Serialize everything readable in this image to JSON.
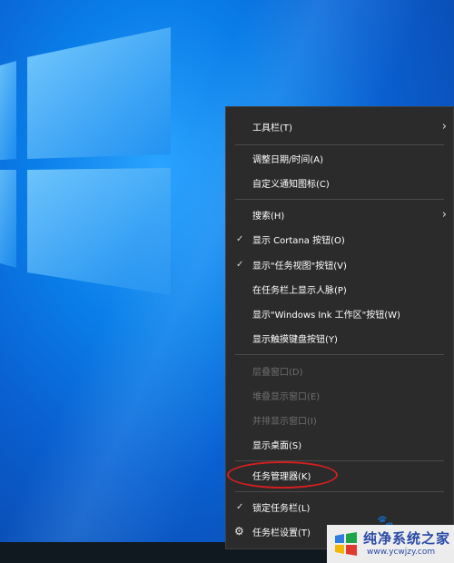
{
  "menu": {
    "items": [
      {
        "label": "工具栏(T)",
        "submenu": true
      },
      {
        "label": "调整日期/时间(A)"
      },
      {
        "label": "自定义通知图标(C)"
      },
      {
        "label": "搜索(H)",
        "submenu": true
      },
      {
        "label": "显示 Cortana 按钮(O)",
        "checked": true
      },
      {
        "label": "显示\"任务视图\"按钮(V)",
        "checked": true
      },
      {
        "label": "在任务栏上显示人脉(P)"
      },
      {
        "label": "显示\"Windows Ink 工作区\"按钮(W)"
      },
      {
        "label": "显示触摸键盘按钮(Y)"
      },
      {
        "label": "层叠窗口(D)",
        "disabled": true
      },
      {
        "label": "堆叠显示窗口(E)",
        "disabled": true
      },
      {
        "label": "并排显示窗口(I)",
        "disabled": true
      },
      {
        "label": "显示桌面(S)"
      },
      {
        "label": "任务管理器(K)",
        "highlighted": true
      },
      {
        "label": "锁定任务栏(L)",
        "checked": true
      },
      {
        "label": "任务栏设置(T)",
        "icon": "gear-icon"
      }
    ]
  },
  "watermark": {
    "title": "纯净系统之家",
    "url": "www.ycwjzy.com"
  },
  "colors": {
    "menu_bg": "#2b2b2b",
    "highlight": "#d11f1f",
    "desktop": "#0a6fe0"
  }
}
